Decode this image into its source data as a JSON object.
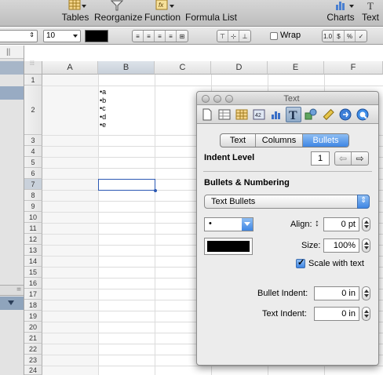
{
  "toolbar": {
    "tables_label": "Tables",
    "reorganize_label": "Reorganize",
    "function_label": "Function",
    "formula_list_label": "Formula List",
    "charts_label": "Charts",
    "text_label": "Text"
  },
  "format_bar": {
    "font_size": "10",
    "wrap_label": "Wrap",
    "number_formats": [
      "1.0",
      "$",
      "%",
      "✓"
    ],
    "text_color": "#000000"
  },
  "sheet": {
    "columns": [
      "A",
      "B",
      "C",
      "D",
      "E",
      "F"
    ],
    "rows": [
      "1",
      "2",
      "3",
      "4",
      "5",
      "6",
      "7",
      "8",
      "9",
      "10",
      "11",
      "12",
      "13",
      "14",
      "15",
      "16",
      "17",
      "18",
      "19",
      "20",
      "21",
      "22",
      "23",
      "24"
    ],
    "selected_column": "B",
    "selected_row": "7",
    "cell_b2_bullets": [
      "•a",
      "•b",
      "•c",
      "•d",
      "•e"
    ]
  },
  "inspector": {
    "title": "Text",
    "tabs": [
      "Text",
      "Columns",
      "Bullets"
    ],
    "active_tab": "Bullets",
    "indent_level_label": "Indent Level",
    "indent_level_value": "1",
    "bullets_numbering_label": "Bullets & Numbering",
    "bullets_type": "Text Bullets",
    "bullet_char": "•",
    "align_label": "Align:",
    "align_value": "0 pt",
    "size_label": "Size:",
    "size_value": "100%",
    "scale_with_text_label": "Scale with text",
    "scale_with_text_checked": true,
    "bullet_color": "#000000",
    "bullet_indent_label": "Bullet Indent:",
    "bullet_indent_value": "0 in",
    "text_indent_label": "Text Indent:",
    "text_indent_value": "0 in"
  },
  "colors": {
    "accent": "#3f86e4",
    "selection": "#2b58b3"
  }
}
